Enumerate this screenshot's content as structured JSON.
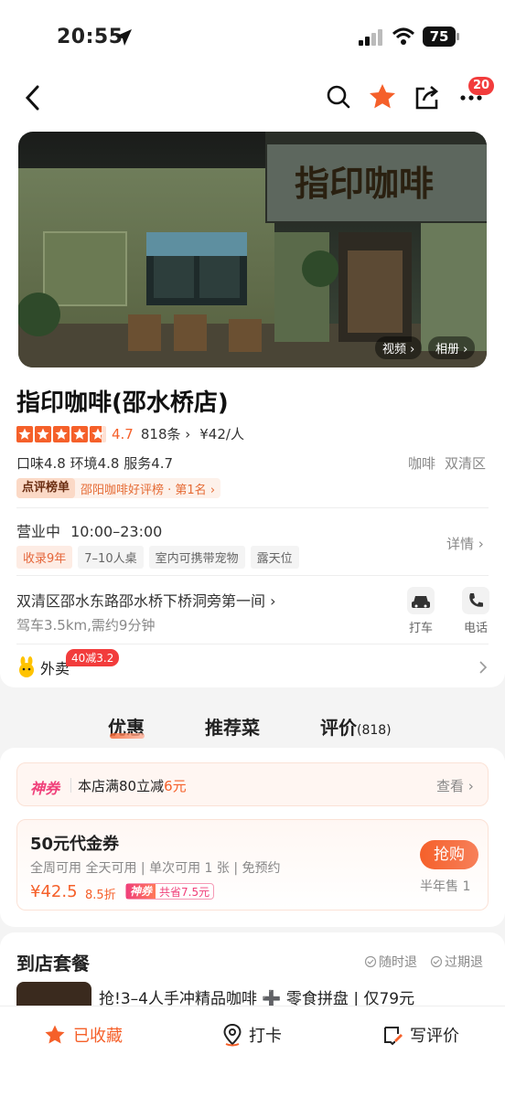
{
  "status": {
    "time": "20:55",
    "battery": "75"
  },
  "nav": {
    "badge": "20",
    "icons": [
      "back-icon",
      "search-icon",
      "star-icon",
      "share-icon",
      "more-icon"
    ]
  },
  "hero": {
    "sign_text": "指印咖啡",
    "video_label": "视频 ›",
    "album_label": "相册 ›"
  },
  "shop": {
    "name": "指印咖啡(邵水桥店)",
    "rating": "4.7",
    "stars": 4.7,
    "reviews": "818条 ›",
    "price": "¥42/人",
    "scores": "口味4.8  环境4.8  服务4.7",
    "category": "咖啡",
    "district": "双清区",
    "rank_badge": "点评榜单",
    "rank_text": "邵阳咖啡好评榜 · 第1名 ›",
    "status": "营业中",
    "hours": "10:00–23:00",
    "details": "详情 ›",
    "tags": [
      "收录9年",
      "7–10人桌",
      "室内可携带宠物",
      "露天位"
    ],
    "address": "双清区邵水东路邵水桥下桥洞旁第一间 ›",
    "distance": "驾车3.5km,需约9分钟",
    "taxi": "打车",
    "phone": "电话",
    "delivery": "外卖",
    "delivery_badge": "40减3.2"
  },
  "tabs": {
    "offers": "优惠",
    "dishes": "推荐菜",
    "reviews": "评价",
    "reviews_count": "(818)"
  },
  "coupon": {
    "brand": "神券",
    "text": "本店满80立减",
    "amount": "6元",
    "view": "查看 ›"
  },
  "voucher": {
    "title": "50元代金券",
    "conditions": "全周可用 全天可用 | 单次可用 1 张 | 免预约",
    "price": "¥42.5",
    "discount": "8.5折",
    "brand": "神券",
    "saving": "共省7.5元",
    "buy": "抢购",
    "sold": "半年售 1"
  },
  "package": {
    "section_title": "到店套餐",
    "refund_any": "随时退",
    "refund_expired": "过期退",
    "item": "抢!3–4人手冲精品咖啡 ➕ 零食拼盘 | 仅79元"
  },
  "bottom": {
    "saved": "已收藏",
    "checkin": "打卡",
    "review": "写评价"
  },
  "colors": {
    "accent": "#f5602a",
    "badge": "#f23c3c"
  }
}
